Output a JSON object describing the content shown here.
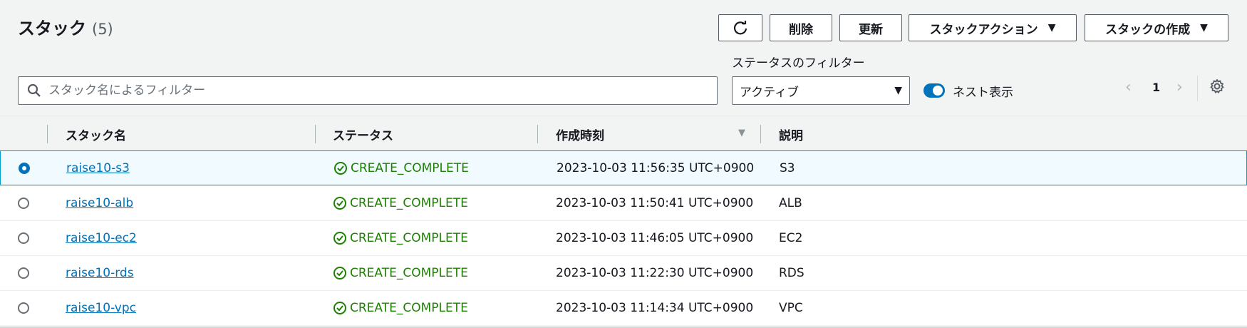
{
  "header": {
    "title": "スタック",
    "count": "(5)"
  },
  "toolbar": {
    "refresh_icon": "refresh-icon",
    "delete_label": "削除",
    "update_label": "更新",
    "stack_actions_label": "スタックアクション",
    "create_stack_label": "スタックの作成"
  },
  "filters": {
    "search_placeholder": "スタック名によるフィルター",
    "status_filter_label": "ステータスのフィルター",
    "status_filter_value": "アクティブ",
    "nested_label": "ネスト表示",
    "nested_on": true
  },
  "pagination": {
    "current_page": "1"
  },
  "table": {
    "headers": {
      "name": "スタック名",
      "status": "ステータス",
      "created": "作成時刻",
      "description": "説明"
    },
    "rows": [
      {
        "name": "raise10-s3",
        "status": "CREATE_COMPLETE",
        "created": "2023-10-03 11:56:35 UTC+0900",
        "description": "S3",
        "selected": true
      },
      {
        "name": "raise10-alb",
        "status": "CREATE_COMPLETE",
        "created": "2023-10-03 11:50:41 UTC+0900",
        "description": "ALB",
        "selected": false
      },
      {
        "name": "raise10-ec2",
        "status": "CREATE_COMPLETE",
        "created": "2023-10-03 11:46:05 UTC+0900",
        "description": "EC2",
        "selected": false
      },
      {
        "name": "raise10-rds",
        "status": "CREATE_COMPLETE",
        "created": "2023-10-03 11:22:30 UTC+0900",
        "description": "RDS",
        "selected": false
      },
      {
        "name": "raise10-vpc",
        "status": "CREATE_COMPLETE",
        "created": "2023-10-03 11:14:34 UTC+0900",
        "description": "VPC",
        "selected": false
      }
    ]
  },
  "colors": {
    "link": "#0073bb",
    "success": "#1d8102",
    "selected_row_bg": "#f1faff",
    "selected_row_border": "#00a1c9"
  }
}
